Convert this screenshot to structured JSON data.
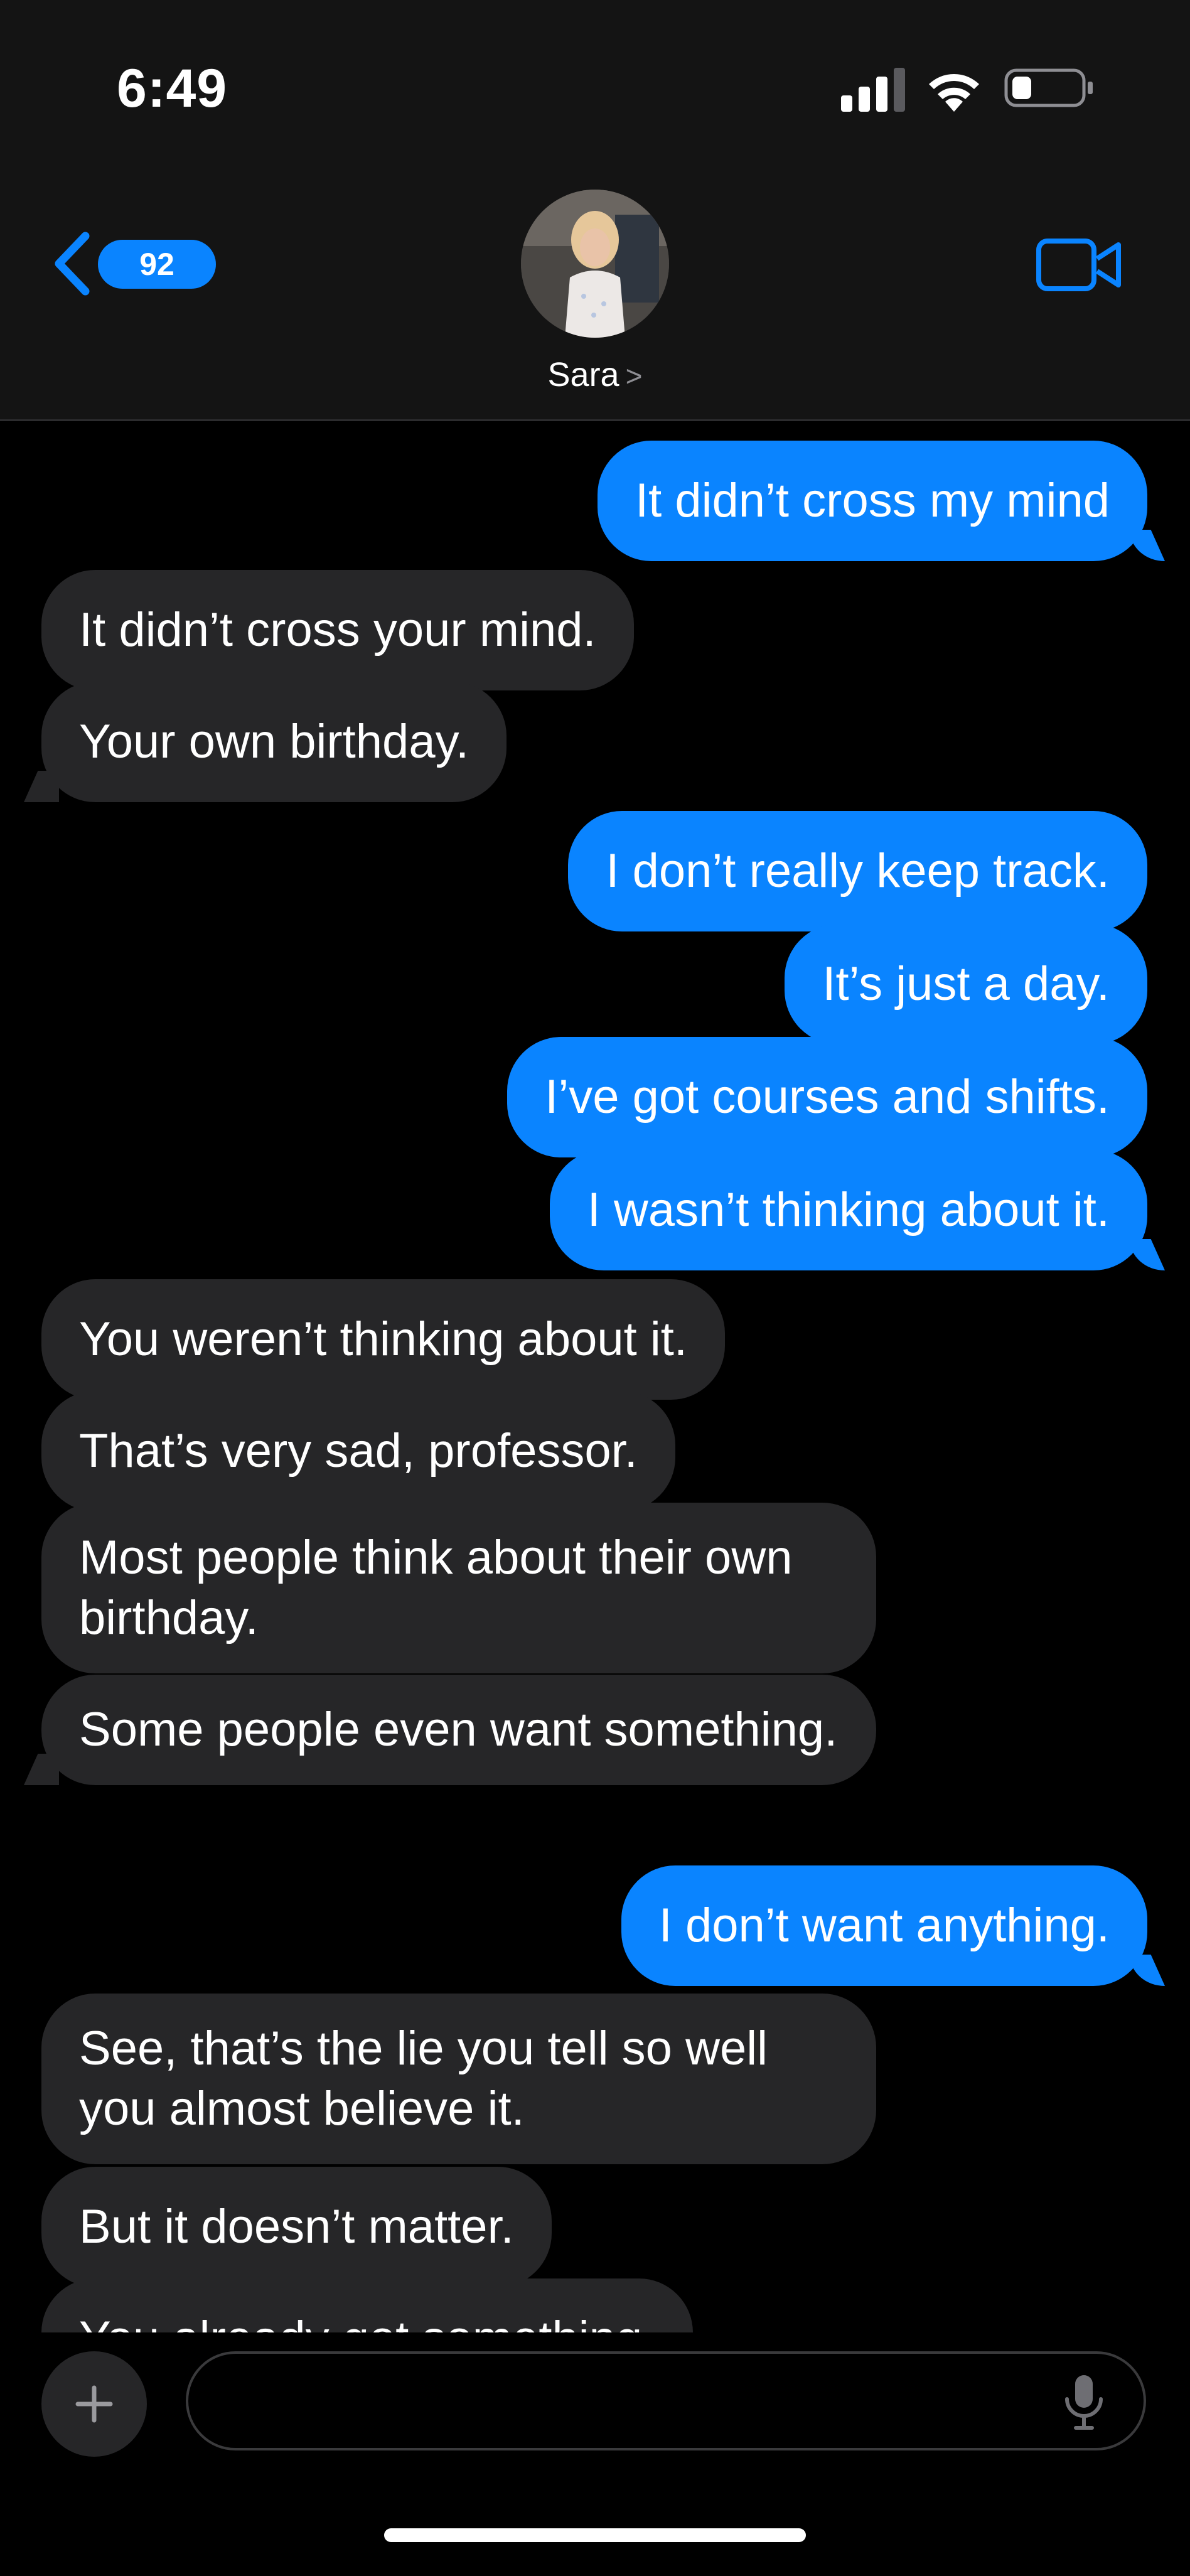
{
  "status_bar": {
    "time": "6:49"
  },
  "header": {
    "back_badge": "92",
    "contact_name": "Sara",
    "contact_chevron": ">"
  },
  "messages": [
    {
      "direction": "sent",
      "text": "It didn’t cross my mind"
    },
    {
      "direction": "received",
      "text": "It didn’t cross your mind."
    },
    {
      "direction": "received",
      "text": "Your own birthday."
    },
    {
      "direction": "sent",
      "text": "I don’t really keep track."
    },
    {
      "direction": "sent",
      "text": "It’s just a day."
    },
    {
      "direction": "sent",
      "text": "I’ve got courses and shifts."
    },
    {
      "direction": "sent",
      "text": "I wasn’t thinking about it."
    },
    {
      "direction": "received",
      "text": "You weren’t thinking about it."
    },
    {
      "direction": "received",
      "text": "That’s very sad, professor."
    },
    {
      "direction": "received",
      "text": "Most people think about their own birthday."
    },
    {
      "direction": "received",
      "text": "Some people even want something."
    },
    {
      "direction": "sent",
      "text": "I don’t want anything."
    },
    {
      "direction": "received",
      "text": "See, that’s the lie you tell so well you almost believe it."
    },
    {
      "direction": "received",
      "text": "But it doesn’t matter."
    },
    {
      "direction": "received",
      "text": "You already got something."
    }
  ],
  "composer": {
    "placeholder": ""
  },
  "icons": {
    "back": "chevron-left-icon",
    "video": "video-camera-icon",
    "plus": "plus-icon",
    "mic": "microphone-icon"
  },
  "colors": {
    "sent_bubble": "#0a84ff",
    "received_bubble": "#262628",
    "background": "#000000"
  }
}
